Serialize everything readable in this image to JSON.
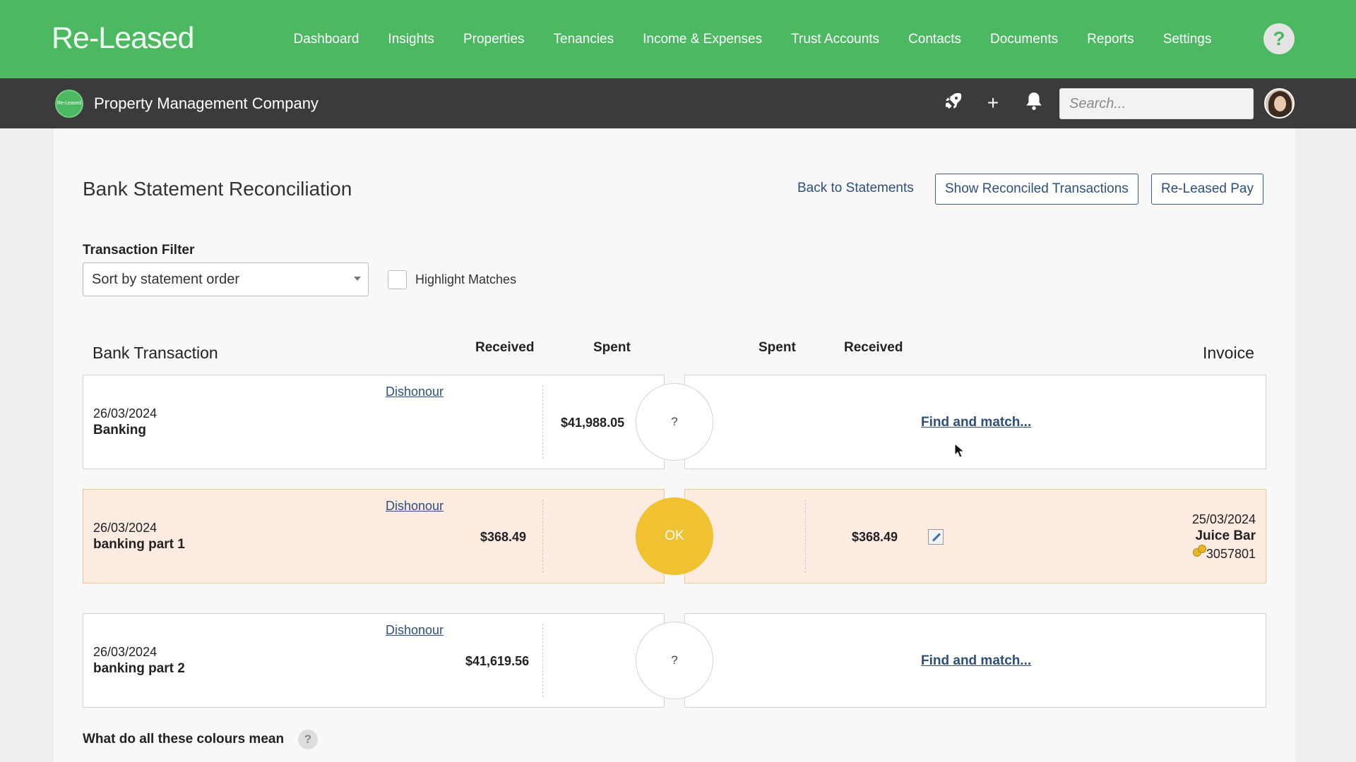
{
  "brand": {
    "logo": "Re-Leased",
    "accent": "#4cb862"
  },
  "nav": {
    "items": [
      "Dashboard",
      "Insights",
      "Properties",
      "Tenancies",
      "Income & Expenses",
      "Trust Accounts",
      "Contacts",
      "Documents",
      "Reports",
      "Settings"
    ],
    "help": "?"
  },
  "subbar": {
    "company_logo_text": "Re-Leased",
    "company": "Property Management Company",
    "add": "+",
    "search_placeholder": "Search..."
  },
  "page": {
    "title": "Bank Statement Reconciliation",
    "back_link": "Back to Statements",
    "show_reconciled": "Show Reconciled Transactions",
    "released_pay": "Re-Leased Pay"
  },
  "filter": {
    "label": "Transaction Filter",
    "selected": "Sort by statement order",
    "highlight_label": "Highlight Matches",
    "highlight_checked": false
  },
  "columns": {
    "bank_transaction": "Bank Transaction",
    "received_left": "Received",
    "spent_left": "Spent",
    "spent_right": "Spent",
    "received_right": "Received",
    "invoice": "Invoice"
  },
  "rows": [
    {
      "dishonour": "Dishonour",
      "date": "26/03/2024",
      "description": "Banking",
      "received": "",
      "spent": "$41,988.05",
      "status": "?",
      "find": "Find and match..."
    },
    {
      "dishonour": "Dishonour",
      "date": "26/03/2024",
      "description": "banking part 1",
      "received": "$368.49",
      "spent": "",
      "status": "OK",
      "match_received": "$368.49",
      "invoice_date": "25/03/2024",
      "invoice_name": "Juice Bar",
      "invoice_number": "3057801"
    },
    {
      "dishonour": "Dishonour",
      "date": "26/03/2024",
      "description": "banking part 2",
      "received": "$41,619.56",
      "spent": "",
      "status": "?",
      "find": "Find and match..."
    }
  ],
  "footer": {
    "colours_question": "What do all these colours mean",
    "help": "?"
  }
}
